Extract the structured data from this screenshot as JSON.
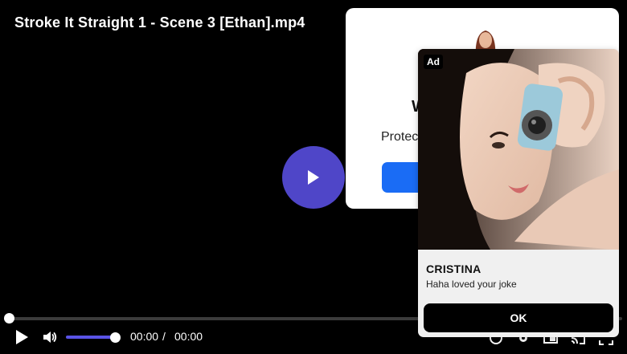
{
  "player": {
    "title": "Stroke It Straight 1 - Scene 3 [Ethan].mp4",
    "current_time": "00:00",
    "separator": "/",
    "duration": "00:00",
    "progress_fraction": 0.0,
    "volume_fraction": 1.0,
    "accent_color": "#4f46c8",
    "icons": {
      "big_play": "play-icon",
      "play": "play-icon",
      "volume": "volume-icon",
      "captions": "captions-icon",
      "settings": "gear-icon",
      "pip": "picture-in-picture-icon",
      "cast": "cast-icon",
      "fullscreen": "fullscreen-icon"
    }
  },
  "modal": {
    "heading_fragment": "W",
    "text_fragment": "Protec",
    "button_color": "#1a6cf5"
  },
  "ad": {
    "badge": "Ad",
    "name": "CRISTINA",
    "message": "Haha loved your joke",
    "button_label": "OK"
  }
}
